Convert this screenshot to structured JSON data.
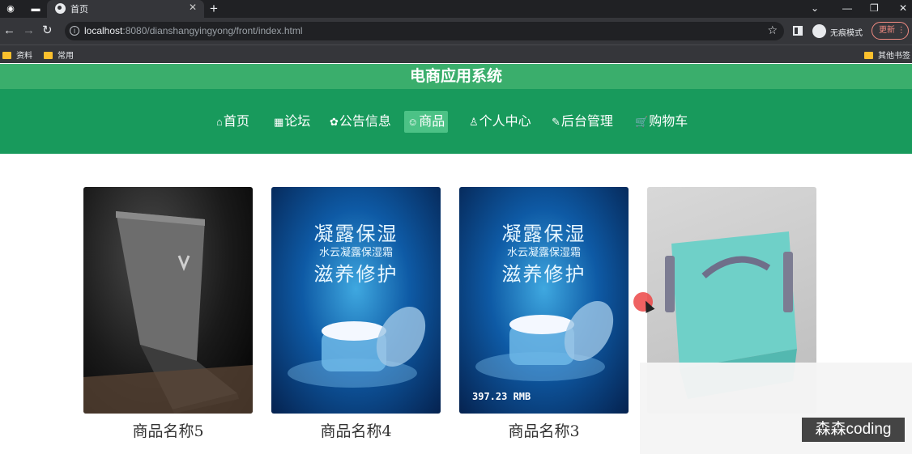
{
  "browser": {
    "tab_title": "首页",
    "url_host": "localhost",
    "url_rest": ":8080/dianshangyingyong/front/index.html",
    "incognito_label": "无痕模式",
    "update_label": "更新",
    "bookmarks": [
      "资料",
      "常用"
    ],
    "other_bookmarks": "其他书签"
  },
  "site": {
    "title": "电商应用系统",
    "nav": [
      {
        "icon": "⌂",
        "label": "首页"
      },
      {
        "icon": "▦",
        "label": "论坛"
      },
      {
        "icon": "✿",
        "label": "公告信息"
      },
      {
        "icon": "☺",
        "label": "商品"
      },
      {
        "icon": "♙",
        "label": "个人中心"
      },
      {
        "icon": "✎",
        "label": "后台管理"
      },
      {
        "icon": "🛒",
        "label": "购物车"
      }
    ],
    "active_nav": "商品"
  },
  "products": [
    {
      "name": "商品名称5"
    },
    {
      "name": "商品名称4",
      "image_text": [
        "凝露保湿",
        "水云凝露保湿霜",
        "滋养修护"
      ]
    },
    {
      "name": "商品名称3",
      "image_text": [
        "凝露保湿",
        "水云凝露保湿霜",
        "滋养修护"
      ],
      "price_text": "397.23 RMB"
    },
    {
      "name": ""
    }
  ],
  "watermark": "森森coding",
  "colors": {
    "title_bar": "#3aae6c",
    "nav_bar": "#189a5c",
    "nav_active": "#4cc286"
  }
}
